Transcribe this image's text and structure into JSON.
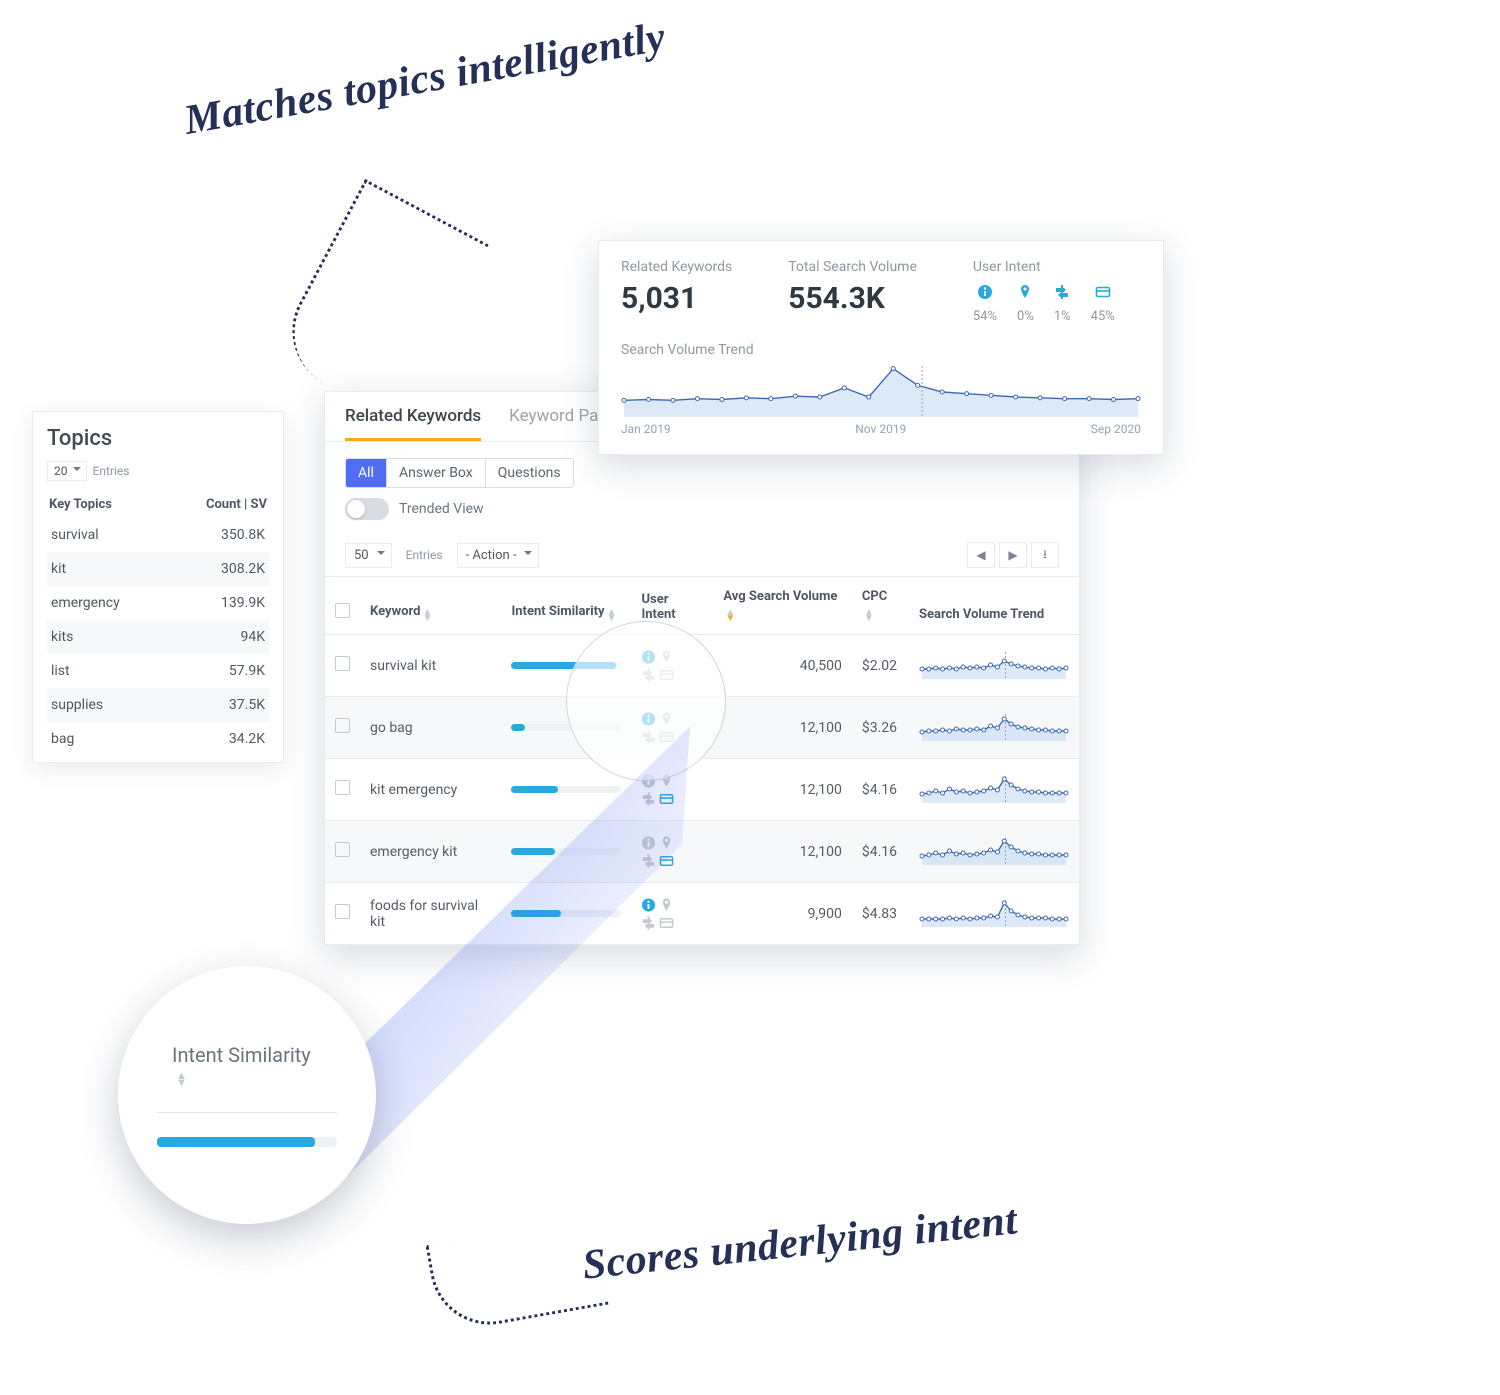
{
  "annotations": {
    "top": "Matches topics intelligently",
    "bottom": "Scores underlying intent"
  },
  "topics_card": {
    "title": "Topics",
    "entries_select": "20",
    "entries_label": "Entries",
    "head_left": "Key Topics",
    "head_right": "Count | SV",
    "rows": [
      {
        "topic": "survival",
        "sv": "350.8K"
      },
      {
        "topic": "kit",
        "sv": "308.2K"
      },
      {
        "topic": "emergency",
        "sv": "139.9K"
      },
      {
        "topic": "kits",
        "sv": "94K"
      },
      {
        "topic": "list",
        "sv": "57.9K"
      },
      {
        "topic": "supplies",
        "sv": "37.5K"
      },
      {
        "topic": "bag",
        "sv": "34.2K"
      }
    ]
  },
  "summary": {
    "related_label": "Related Keywords",
    "related_value": "5,031",
    "tsv_label": "Total Search Volume",
    "tsv_value": "554.3K",
    "ui_label": "User Intent",
    "ui": [
      {
        "icon": "info",
        "pct": "54%"
      },
      {
        "icon": "pin",
        "pct": "0%"
      },
      {
        "icon": "signpost",
        "pct": "1%"
      },
      {
        "icon": "card",
        "pct": "45%"
      }
    ],
    "trend_label": "Search Volume Trend",
    "axis": [
      "Jan 2019",
      "Nov 2019",
      "Sep 2020"
    ]
  },
  "main": {
    "tabs": [
      {
        "label": "Related Keywords",
        "active": true
      },
      {
        "label": "Keyword Pa",
        "active": false
      }
    ],
    "pills": [
      {
        "label": "All",
        "active": true
      },
      {
        "label": "Answer Box",
        "active": false
      },
      {
        "label": "Questions",
        "active": false
      }
    ],
    "toggle_label": "Trended View",
    "entries_select": "50",
    "entries_label": "Entries",
    "action_select": "- Action -",
    "columns": {
      "keyword": "Keyword",
      "intent_sim": "Intent Similarity",
      "user_intent": "User Intent",
      "avg_sv": "Avg Search Volume",
      "cpc": "CPC",
      "trend": "Search Volume Trend"
    },
    "rows": [
      {
        "kw": "survival kit",
        "sim": 0.95,
        "icons": [
          "info"
        ],
        "asv": "40,500",
        "cpc": "$2.02"
      },
      {
        "kw": "go bag",
        "sim": 0.12,
        "icons": [
          "info"
        ],
        "asv": "12,100",
        "cpc": "$3.26"
      },
      {
        "kw": "kit emergency",
        "sim": 0.42,
        "icons": [
          "card"
        ],
        "asv": "12,100",
        "cpc": "$4.16"
      },
      {
        "kw": "emergency kit",
        "sim": 0.4,
        "icons": [
          "card"
        ],
        "asv": "12,100",
        "cpc": "$4.16"
      },
      {
        "kw": "foods for survival kit",
        "sim": 0.45,
        "icons": [
          "info"
        ],
        "asv": "9,900",
        "cpc": "$4.83"
      }
    ]
  },
  "lens": {
    "title": "Intent Similarity"
  },
  "chart_data": {
    "summary_trend": {
      "type": "line",
      "title": "Search Volume Trend",
      "xlabel": "",
      "ylabel": "",
      "x_ticks": [
        "Jan 2019",
        "Nov 2019",
        "Sep 2020"
      ],
      "values": [
        20,
        21,
        20,
        22,
        21,
        23,
        22,
        25,
        24,
        35,
        24,
        58,
        38,
        30,
        28,
        26,
        24,
        23,
        22,
        22,
        21,
        22
      ],
      "ylim": [
        0,
        60
      ]
    },
    "row_sparklines": {
      "type": "line",
      "series": [
        {
          "name": "survival kit",
          "values": [
            10,
            10,
            11,
            10,
            11,
            10,
            12,
            11,
            12,
            11,
            14,
            12,
            18,
            15,
            13,
            12,
            11,
            11,
            10,
            11,
            10,
            11
          ]
        },
        {
          "name": "go bag",
          "values": [
            9,
            10,
            10,
            11,
            10,
            12,
            11,
            11,
            12,
            11,
            15,
            13,
            22,
            17,
            14,
            13,
            12,
            11,
            11,
            10,
            10,
            10
          ]
        },
        {
          "name": "kit emergency",
          "values": [
            9,
            10,
            12,
            10,
            14,
            11,
            12,
            10,
            11,
            12,
            15,
            13,
            24,
            18,
            14,
            12,
            11,
            11,
            10,
            10,
            10,
            10
          ]
        },
        {
          "name": "emergency kit",
          "values": [
            9,
            10,
            12,
            10,
            14,
            11,
            12,
            10,
            11,
            12,
            15,
            13,
            24,
            18,
            14,
            12,
            11,
            11,
            10,
            10,
            10,
            10
          ]
        },
        {
          "name": "foods for survival kit",
          "values": [
            8,
            8,
            8,
            8,
            9,
            8,
            9,
            8,
            9,
            9,
            11,
            10,
            24,
            16,
            12,
            10,
            9,
            9,
            9,
            8,
            8,
            8
          ]
        }
      ],
      "ylim": [
        0,
        26
      ]
    }
  }
}
